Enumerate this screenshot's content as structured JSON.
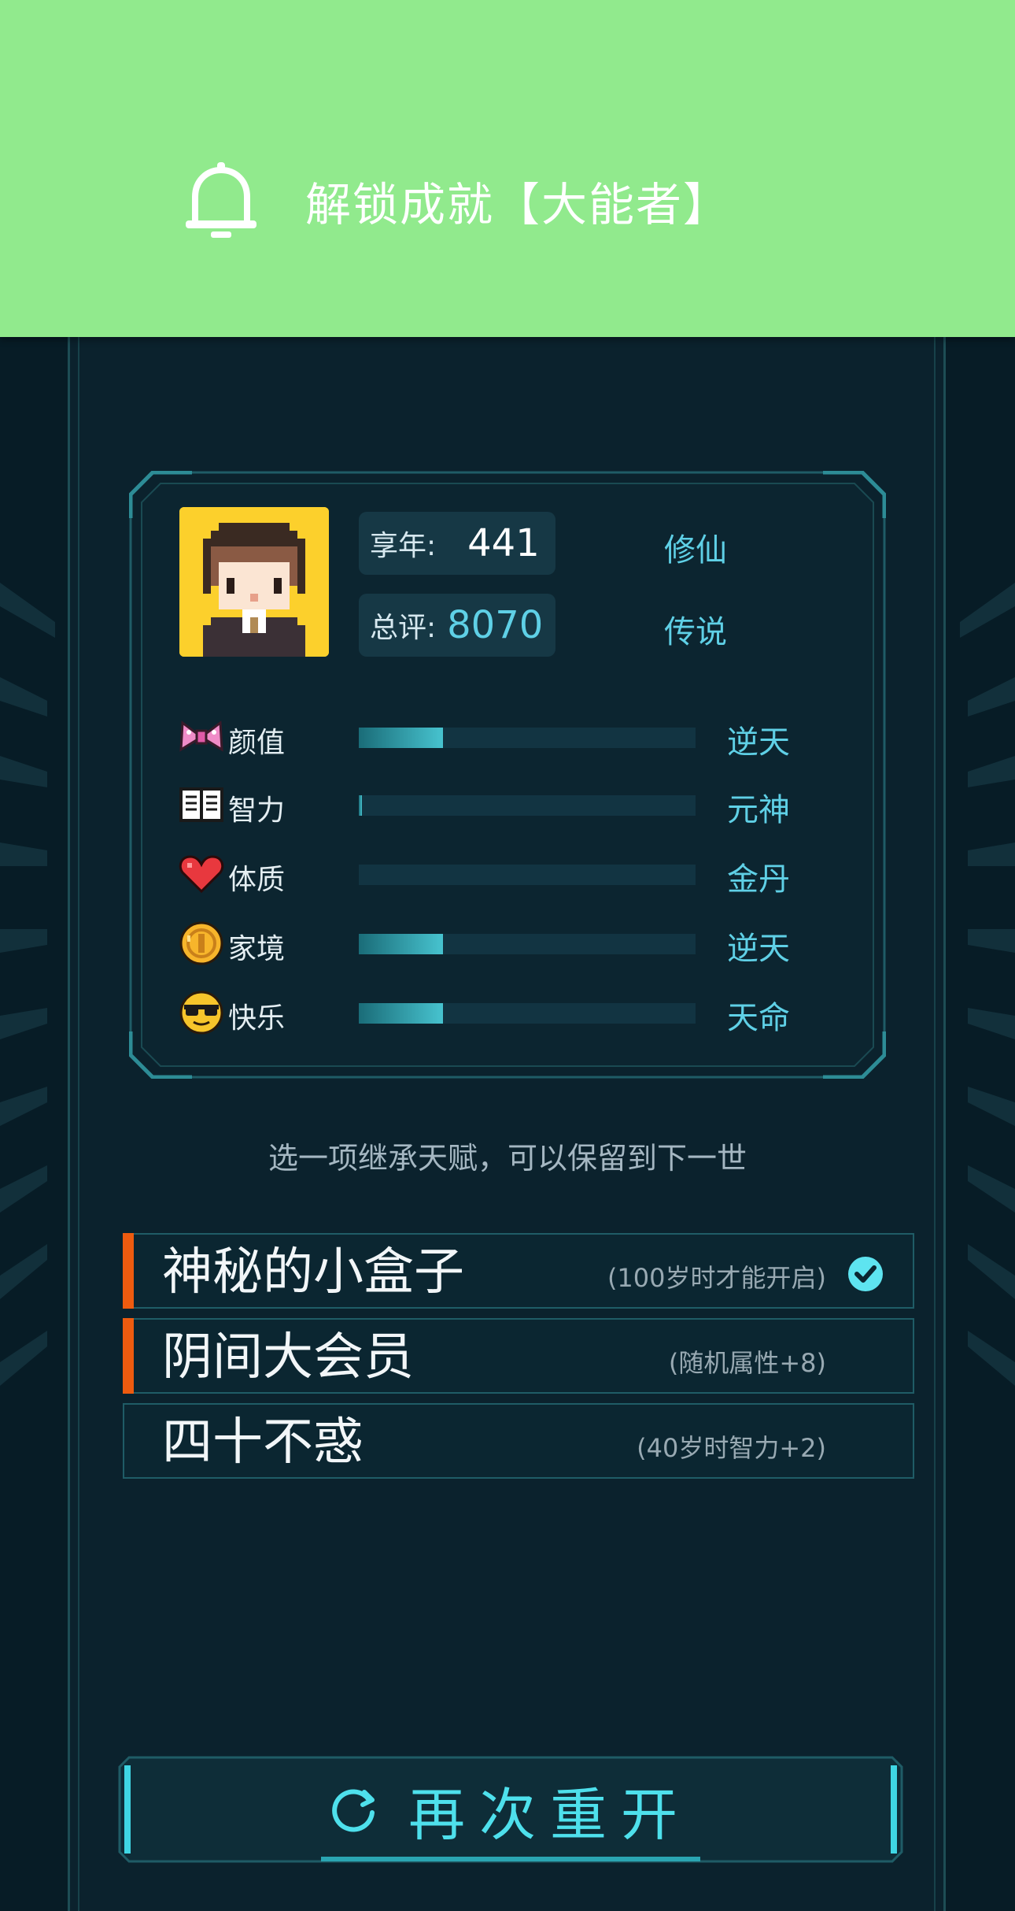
{
  "notification": {
    "icon": "bell-icon",
    "text": "解锁成就【大能者】",
    "background": "#91ea8d"
  },
  "summary": {
    "lifespan_label": "享年:",
    "lifespan_value": "441",
    "lifespan_grade": "修仙",
    "score_label": "总评:",
    "score_value": "8070",
    "score_grade": "传说"
  },
  "attributes": [
    {
      "icon": "bow-icon",
      "label": "颜值",
      "grade": "逆天",
      "fill": 0.25
    },
    {
      "icon": "book-icon",
      "label": "智力",
      "grade": "元神",
      "fill": 0.01
    },
    {
      "icon": "heart-icon",
      "label": "体质",
      "grade": "金丹",
      "fill": 0.0
    },
    {
      "icon": "coin-icon",
      "label": "家境",
      "grade": "逆天",
      "fill": 0.25
    },
    {
      "icon": "sunglasses-face-icon",
      "label": "快乐",
      "grade": "天命",
      "fill": 0.25
    }
  ],
  "hint": "选一项继承天赋，可以保留到下一世",
  "talents": [
    {
      "name": "神秘的小盒子",
      "desc": "(100岁时才能开启)",
      "selected": true,
      "checked": true
    },
    {
      "name": "阴间大会员",
      "desc": "(随机属性+8)",
      "selected": true,
      "checked": false
    },
    {
      "name": "四十不惑",
      "desc": "(40岁时智力+2)",
      "selected": false,
      "checked": false
    }
  ],
  "restart": {
    "label": "再次重开",
    "icon": "restart-icon"
  },
  "colors": {
    "accent": "#4ee0ec",
    "grade": "#5fd0e6",
    "selected_marker": "#ee5b0f",
    "background": "#071c26"
  }
}
